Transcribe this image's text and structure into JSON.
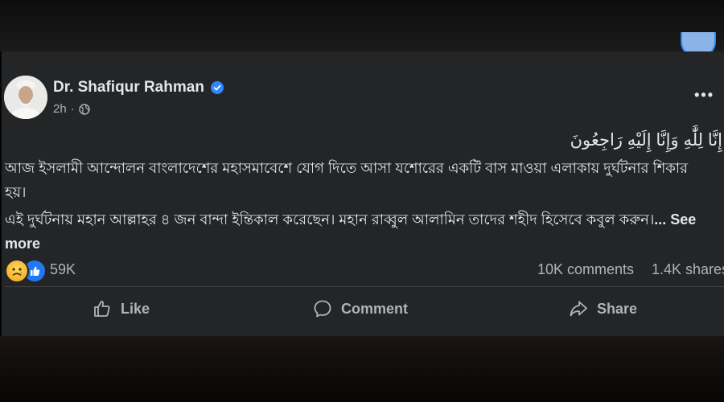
{
  "post": {
    "author": "Dr. Shafiqur Rahman",
    "time": "2h",
    "more_label": "•••",
    "arabic_line": "إِنَّا لِلَّٰهِ وَإِنَّا إِلَيْهِ رَاجِعُونَ",
    "paragraph_1": "আজ ইসলামী আন্দোলন বাংলাদেশের মহাসমাবেশে যোগ দিতে আসা যশোরের একটি বাস মাওয়া এলাকায় দুর্ঘটনার শিকার হয়।",
    "paragraph_2": "এই দুর্ঘটনায় মহান আল্লাহর ৪ জন বান্দা ইন্তিকাল করেছেন। মহান রাব্বুল আলামিন তাদের শহীদ হিসেবে কবুল করুন।",
    "see_more": "... See more",
    "reaction_count": "59K",
    "comments": "10K comments",
    "shares": "1.4K shares"
  },
  "actions": {
    "like": "Like",
    "comment": "Comment",
    "share": "Share"
  },
  "colors": {
    "card_bg": "#242526",
    "text_primary": "#e4e6eb",
    "text_secondary": "#b0b3b8",
    "verified": "#2d88ff",
    "like_blue": "#2078f4"
  }
}
